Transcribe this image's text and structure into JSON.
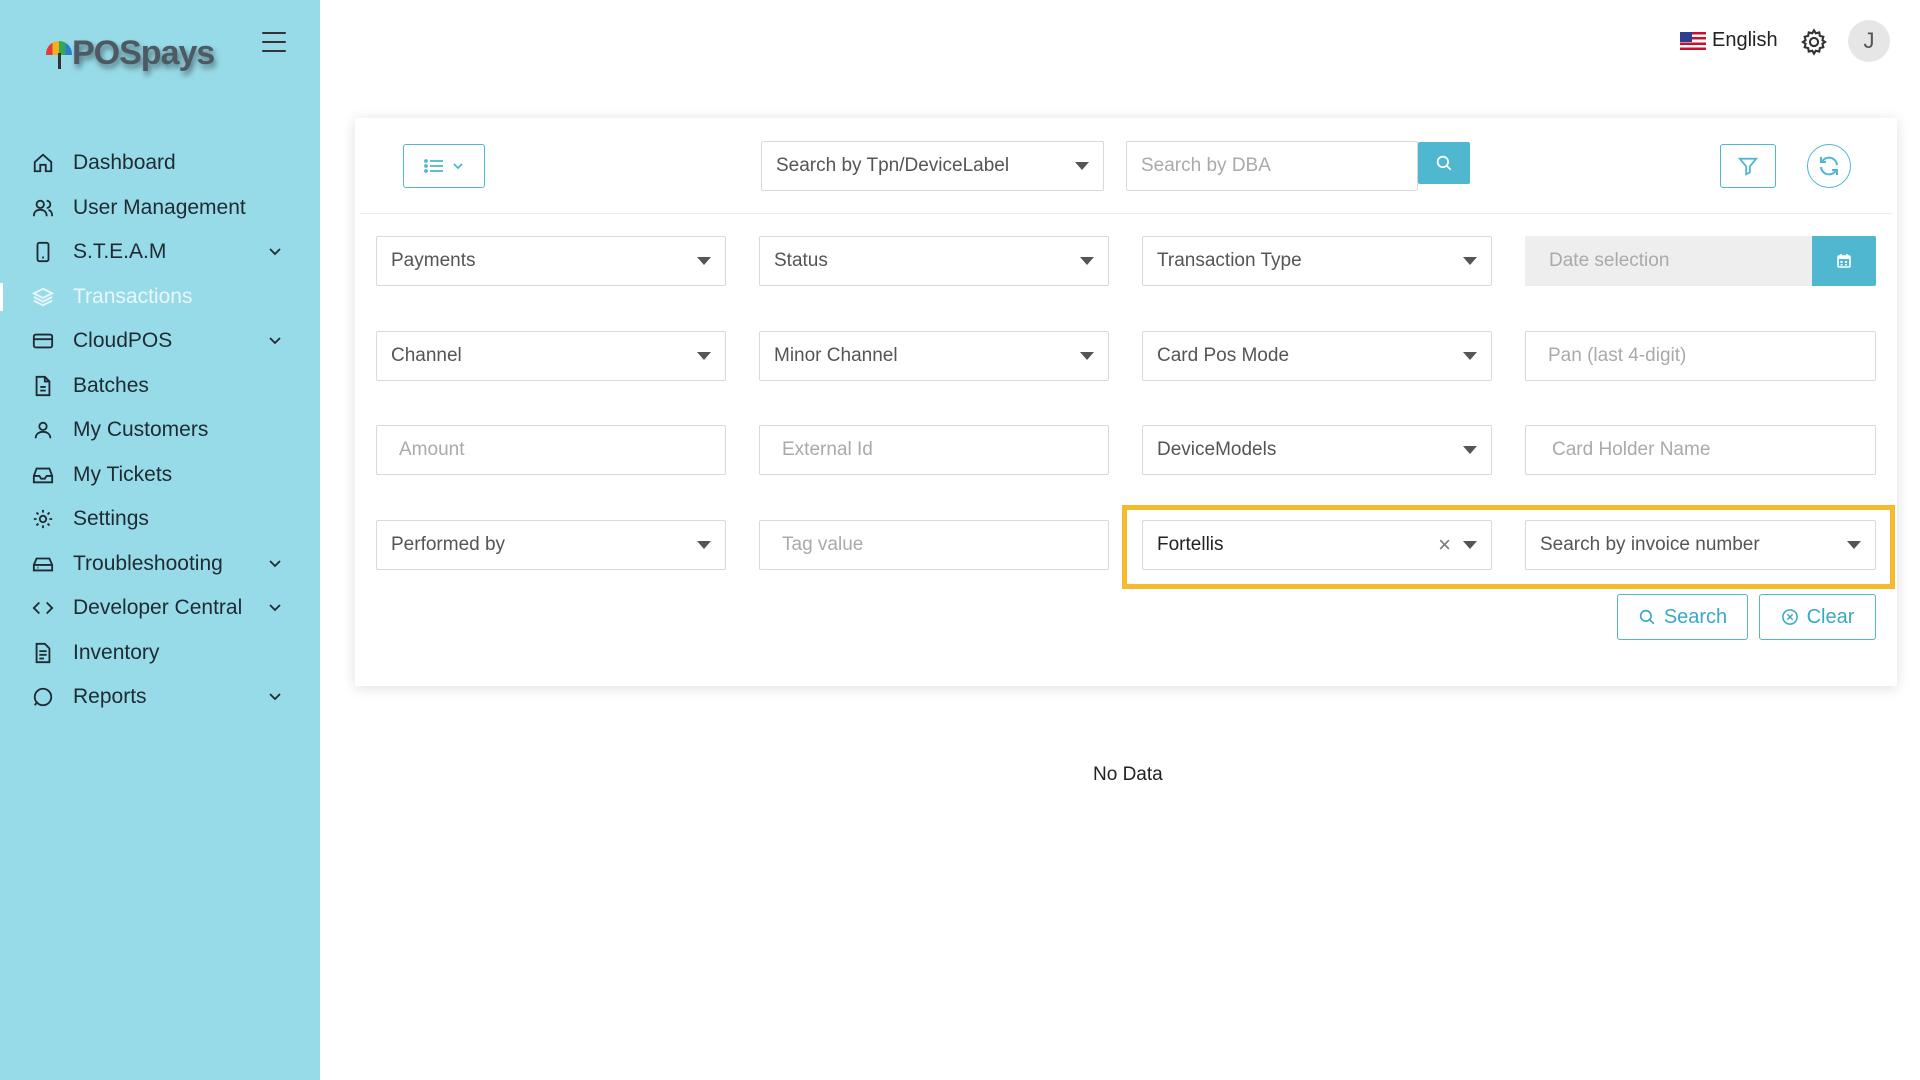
{
  "app": {
    "logo_text": "POSpays",
    "accent_color": "#4fb7d0",
    "sidebar_color": "#97dbe8",
    "highlight_color": "#f5bb2c"
  },
  "sidebar": {
    "items": [
      {
        "label": "Dashboard",
        "icon": "home-icon",
        "expandable": false
      },
      {
        "label": "User Management",
        "icon": "users-icon",
        "expandable": false
      },
      {
        "label": "S.T.E.A.M",
        "icon": "device-icon",
        "expandable": true
      },
      {
        "label": "Transactions",
        "icon": "layers-icon",
        "expandable": false,
        "active": true
      },
      {
        "label": "CloudPOS",
        "icon": "card-icon",
        "expandable": true
      },
      {
        "label": "Batches",
        "icon": "file-icon",
        "expandable": false
      },
      {
        "label": "My Customers",
        "icon": "user-icon",
        "expandable": false
      },
      {
        "label": "My Tickets",
        "icon": "inbox-icon",
        "expandable": false
      },
      {
        "label": "Settings",
        "icon": "gear-icon",
        "expandable": false
      },
      {
        "label": "Troubleshooting",
        "icon": "drive-icon",
        "expandable": true
      },
      {
        "label": "Developer Central",
        "icon": "code-icon",
        "expandable": true
      },
      {
        "label": "Inventory",
        "icon": "document-icon",
        "expandable": false
      },
      {
        "label": "Reports",
        "icon": "chat-icon",
        "expandable": true
      }
    ]
  },
  "header": {
    "language": "English",
    "avatar_initial": "J"
  },
  "toolbar": {
    "tpn_placeholder": "Search by Tpn/DeviceLabel",
    "dba_placeholder": "Search by DBA"
  },
  "filters": {
    "payments": "Payments",
    "status": "Status",
    "transaction_type": "Transaction Type",
    "date_placeholder": "Date selection",
    "channel": "Channel",
    "minor_channel": "Minor Channel",
    "card_pos_mode": "Card Pos Mode",
    "pan_placeholder": "Pan (last 4-digit)",
    "amount_placeholder": "Amount",
    "external_id_placeholder": "External Id",
    "device_models": "DeviceModels",
    "card_holder_placeholder": "Card Holder Name",
    "performed_by": "Performed by",
    "tag_value_placeholder": "Tag value",
    "integration_value": "Fortellis",
    "invoice_placeholder": "Search by invoice number"
  },
  "actions": {
    "search_label": "Search",
    "clear_label": "Clear"
  },
  "results": {
    "empty_text": "No Data"
  }
}
